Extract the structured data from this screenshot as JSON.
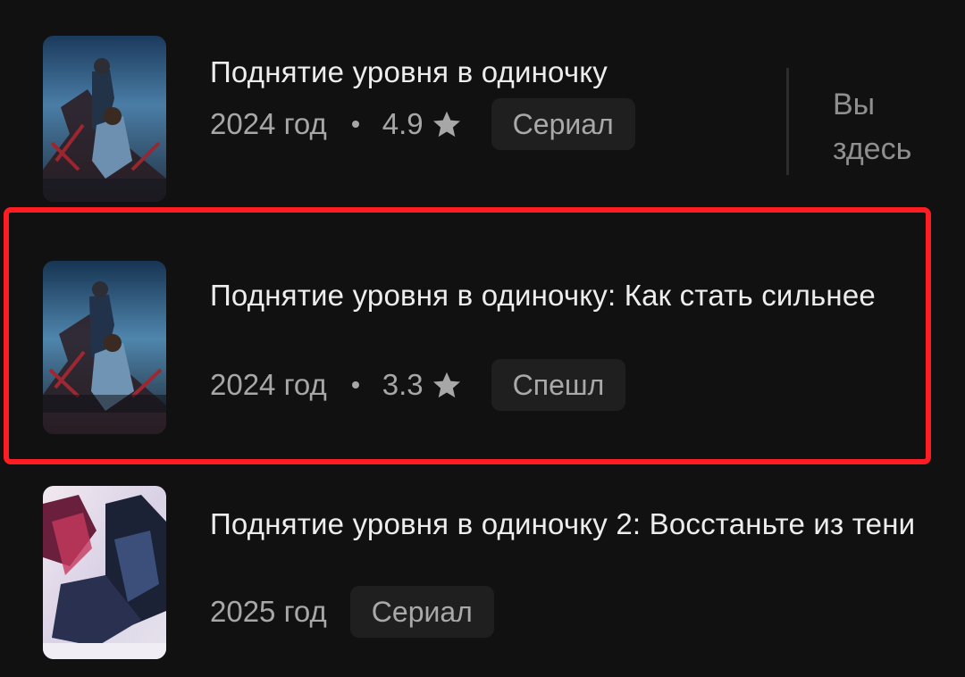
{
  "items": [
    {
      "title": "Поднятие уровня в одиночку",
      "year": "2024 год",
      "rating": "4.9",
      "badge": "Сериал",
      "current_label": "Вы здесь",
      "poster_icon": "anime-poster-thumbnail"
    },
    {
      "title": "Поднятие уровня в одиночку: Как стать сильнее",
      "year": "2024 год",
      "rating": "3.3",
      "badge": "Спешл",
      "poster_icon": "anime-poster-thumbnail"
    },
    {
      "title": "Поднятие уровня в одиночку 2: Восстаньте из тени",
      "year": "2025 год",
      "badge": "Сериал",
      "poster_icon": "anime-poster-thumbnail"
    }
  ],
  "colors": {
    "background": "#111111",
    "highlight": "#ff1d24",
    "text_primary": "#ededed",
    "text_secondary": "#a7a7a7",
    "badge_bg": "#1f1f1f"
  },
  "icons": {
    "rating": "star-icon"
  }
}
